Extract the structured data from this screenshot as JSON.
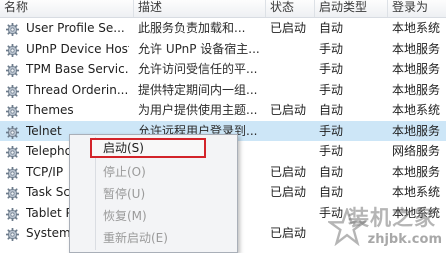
{
  "columns": {
    "name": "名称",
    "desc": "描述",
    "status": "状态",
    "startup": "启动类型",
    "logon": "登录为"
  },
  "rows": [
    {
      "name": "User Profile Se...",
      "desc": "此服务负责加载和...",
      "status": "已启动",
      "startup": "自动",
      "logon": "本地系统"
    },
    {
      "name": "UPnP Device Host",
      "desc": "允许 UPnP 设备宿主...",
      "status": "",
      "startup": "手动",
      "logon": "本地服务"
    },
    {
      "name": "TPM Base Servic...",
      "desc": "允许访问受信任的平...",
      "status": "",
      "startup": "手动",
      "logon": "本地服务"
    },
    {
      "name": "Thread Orderin...",
      "desc": "提供特定期间内一组...",
      "status": "",
      "startup": "手动",
      "logon": "本地服务"
    },
    {
      "name": "Themes",
      "desc": "为用户提供使用主题...",
      "status": "已启动",
      "startup": "自动",
      "logon": "本地系统"
    },
    {
      "name": "Telnet",
      "desc": "允许远程用户登录到...",
      "status": "",
      "startup": "手动",
      "logon": "本地服务"
    },
    {
      "name": "Telepho",
      "desc": "PI (T...",
      "status": "",
      "startup": "手动",
      "logon": "网络服务"
    },
    {
      "name": "TCP/IP",
      "desc": "etBT...",
      "status": "已启动",
      "startup": "自动",
      "logon": "本地服务"
    },
    {
      "name": "Task Sc",
      "desc": "和计...",
      "status": "已启动",
      "startup": "自动",
      "logon": "本地系统"
    },
    {
      "name": "Tablet P",
      "desc": "平...",
      "status": "",
      "startup": "手动",
      "logon": "本地系统"
    },
    {
      "name": "System",
      "desc": "...",
      "status": "已启动",
      "startup": "",
      "logon": ""
    }
  ],
  "context_menu": {
    "start": "启动(S)",
    "stop": "停止(O)",
    "pause": "暂停(U)",
    "resume": "恢复(M)",
    "restart": "重新启动(E)"
  },
  "watermark": {
    "main": "装机之家",
    "url": "zhjbk.com"
  },
  "colors": {
    "selected_row": "#cde6f7",
    "highlight_border": "#d3242a"
  }
}
